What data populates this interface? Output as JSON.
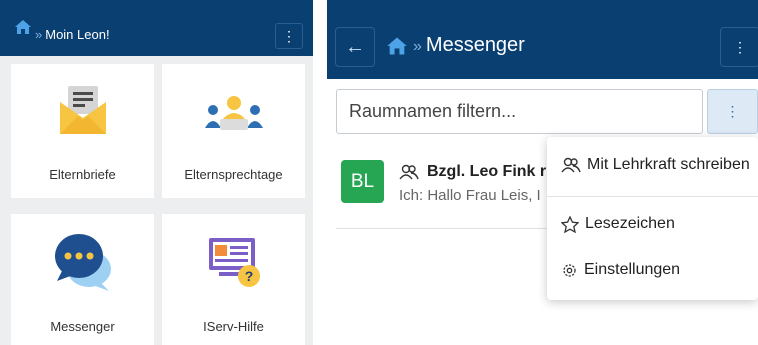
{
  "left_panel": {
    "header": {
      "greeting": "Moin Leon!"
    },
    "tiles": [
      {
        "label": "Elternbriefe",
        "icon": "envelope-letter-icon"
      },
      {
        "label": "Elternsprechtage",
        "icon": "parent-meeting-icon"
      },
      {
        "label": "Messenger",
        "icon": "chat-bubbles-icon"
      },
      {
        "label": "IServ-Hilfe",
        "icon": "help-screen-icon"
      }
    ]
  },
  "right_panel": {
    "header": {
      "title": "Messenger"
    },
    "filter": {
      "placeholder": "Raumnamen filtern..."
    },
    "rooms": [
      {
        "avatar": "BL",
        "name": "Bzgl. Leo Fink r",
        "last_message": "Ich: Hallo Frau Leis, I"
      }
    ],
    "menu": {
      "items": [
        {
          "label": "Mit Lehrkraft schreiben",
          "icon": "people-icon"
        },
        {
          "label": "Lesezeichen",
          "icon": "star-icon"
        },
        {
          "label": "Einstellungen",
          "icon": "gear-icon"
        }
      ]
    }
  },
  "colors": {
    "header": "#0a3f72",
    "avatar": "#26a552",
    "accent": "#2d6aa6"
  }
}
